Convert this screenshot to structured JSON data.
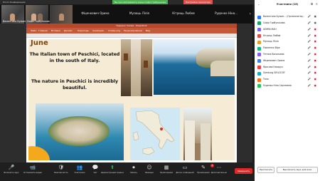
{
  "title_bar": {
    "app_title": "Zoom Конференция",
    "share_banner": "Вы просматриваете экран Софи Горбунькова",
    "stop_label": "Настройки просмотра"
  },
  "strip": {
    "tiles": [
      {
        "name": "Валентина Бужан..."
      },
      {
        "name": "Софи Горбунькова"
      },
      {
        "name": "Фіценкович Орина"
      },
      {
        "name": "Мусюць Лілія"
      },
      {
        "name": "Кітриць Любов"
      },
      {
        "name": "Руденко Ніна..."
      }
    ]
  },
  "powerpoint": {
    "doc_title": "Подорож Італією - PowerPoint",
    "ribbon": [
      "Файл",
      "Главная",
      "Вставка",
      "Дизайн",
      "Переходы",
      "Анимация",
      "Слайд-шоу",
      "Рецензирование",
      "Вид"
    ]
  },
  "slide": {
    "heading": "June",
    "line1": "The Italian town of Peschici, located in the south of Italy.",
    "line2": "The nature in Peschici is incredibly beautiful."
  },
  "panel": {
    "title": "Участники (18)",
    "participants": [
      {
        "name": "Валентина Бужан... (Организатор, я)",
        "color": "#2d7cf6",
        "mic": "on",
        "cam": "on"
      },
      {
        "name": "Софи Горбунькова",
        "color": "#1aa56a",
        "mic": "on",
        "cam": "on"
      },
      {
        "name": "ADMIN-МАН",
        "color": "#7b61ff",
        "mic": "off",
        "cam": "off"
      },
      {
        "name": "Кітриць Любов",
        "color": "#e94b4b",
        "mic": "off",
        "cam": "off"
      },
      {
        "name": "Мусюць Лілія",
        "color": "#f59e0b",
        "mic": "off",
        "cam": "off"
      },
      {
        "name": "Павленко Віра",
        "color": "#10b981",
        "mic": "off",
        "cam": "off"
      },
      {
        "name": "Тетяна Васильева",
        "color": "#8b5cf6",
        "mic": "off",
        "cam": "off"
      },
      {
        "name": "Фіценкович Орина",
        "color": "#3b82f6",
        "mic": "off",
        "cam": "off"
      },
      {
        "name": "Ярослав Назарук",
        "color": "#ef4444",
        "mic": "off",
        "cam": "off"
      },
      {
        "name": "Samsung SM-A315F",
        "color": "#06b6d4",
        "mic": "off",
        "cam": "off"
      },
      {
        "name": "Таня",
        "color": "#f97316",
        "mic": "off",
        "cam": "off"
      },
      {
        "name": "Руденко Ніна Сергеевна",
        "color": "#22c55e",
        "mic": "off",
        "cam": "off"
      }
    ],
    "invite_label": "Пригласить",
    "mute_all_label": "Выключить звук для всех"
  },
  "toolbar": {
    "items": [
      {
        "icon": "mic-icon",
        "glyph": "🎤",
        "label": "Включить звук"
      },
      {
        "icon": "video-icon",
        "glyph": "📹",
        "label": "Остановить видео"
      },
      {
        "icon": "security-icon",
        "glyph": "🛡",
        "label": "Безопасность"
      },
      {
        "icon": "participants-icon",
        "glyph": "👥",
        "label": "Участники"
      },
      {
        "icon": "chat-icon",
        "glyph": "💬",
        "label": "Чат"
      },
      {
        "icon": "share-icon",
        "glyph": "⬆",
        "label": "Демонстрация экрана"
      },
      {
        "icon": "record-icon",
        "glyph": "⏺",
        "label": "Запись"
      },
      {
        "icon": "reactions-icon",
        "glyph": "☺",
        "label": "Реакции"
      },
      {
        "icon": "apps-icon",
        "glyph": "▦",
        "label": "Приложения"
      },
      {
        "icon": "whiteboard-icon",
        "glyph": "▭",
        "label": "Доска сообщений"
      },
      {
        "icon": "notes-icon",
        "glyph": "✎",
        "label": "Примечания"
      },
      {
        "icon": "more-icon",
        "glyph": "⋯",
        "label": "Дополнительно"
      }
    ],
    "badge_count": "2",
    "end_label": "Завершить"
  },
  "colors": {
    "slide_bg": "#f6ecd6",
    "heading": "#7a4410",
    "end": "#e02828"
  }
}
